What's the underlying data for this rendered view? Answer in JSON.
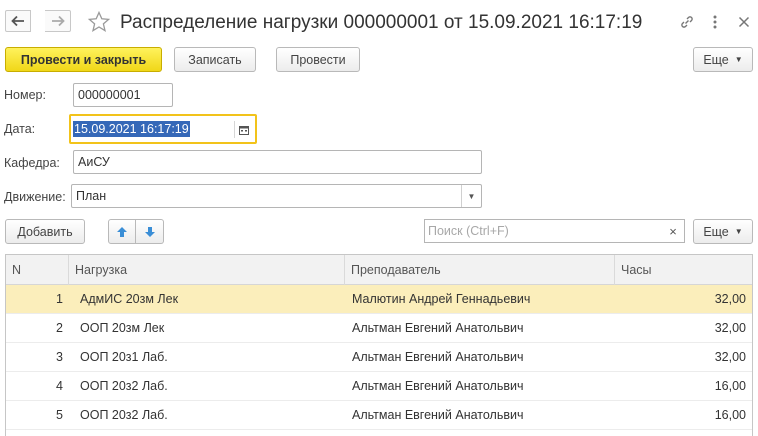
{
  "window": {
    "title": "Распределение нагрузки 000000001 от 15.09.2021 16:17:19"
  },
  "toolbar": {
    "post_close_label": "Провести и закрыть",
    "save_label": "Записать",
    "post_label": "Провести",
    "more_label": "Еще"
  },
  "form": {
    "number_label": "Номер:",
    "number_value": "000000001",
    "date_label": "Дата:",
    "date_value": "15.09.2021 16:17:19",
    "department_label": "Кафедра:",
    "department_value": "АиСУ",
    "movement_label": "Движение:",
    "movement_value": "План"
  },
  "table_toolbar": {
    "add_label": "Добавить",
    "search_placeholder": "Поиск (Ctrl+F)",
    "more_label": "Еще"
  },
  "table": {
    "columns": [
      "N",
      "Нагрузка",
      "Преподаватель",
      "Часы"
    ],
    "rows": [
      {
        "n": "1",
        "load": "АдмИС 20зм Лек",
        "teacher": "Малютин Андрей Геннадьевич",
        "hours": "32,00"
      },
      {
        "n": "2",
        "load": "ООП 20зм Лек",
        "teacher": "Альтман Евгений Анатольвич",
        "hours": "32,00"
      },
      {
        "n": "3",
        "load": "ООП 20з1 Лаб.",
        "teacher": "Альтман Евгений Анатольвич",
        "hours": "32,00"
      },
      {
        "n": "4",
        "load": "ООП 20з2 Лаб.",
        "teacher": "Альтман Евгений Анатольвич",
        "hours": "16,00"
      },
      {
        "n": "5",
        "load": "ООП 20з2 Лаб.",
        "teacher": "Альтман Евгений Анатольвич",
        "hours": "16,00"
      }
    ]
  },
  "icons": [
    "back-arrow-icon",
    "forward-arrow-icon",
    "favorite-star-icon",
    "link-icon",
    "more-vertical-icon",
    "close-icon",
    "calendar-icon",
    "dropdown-icon",
    "move-up-icon",
    "move-down-icon",
    "clear-icon"
  ],
  "colors": {
    "primary_button": "#f0d718",
    "selected_row": "#fbeebb",
    "focus_border": "#f2c31a",
    "selection": "#3568b8",
    "arrow_blue": "#3a8ed6"
  }
}
